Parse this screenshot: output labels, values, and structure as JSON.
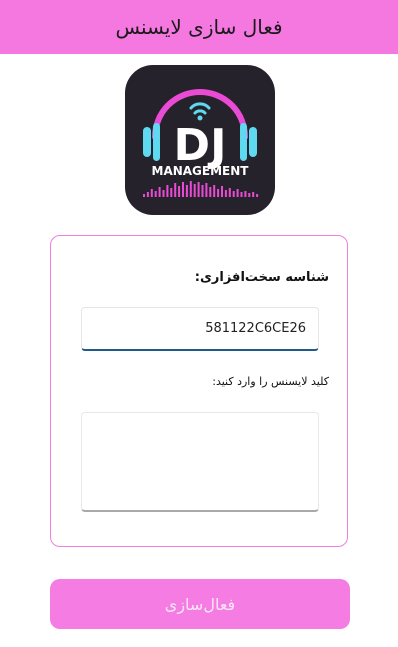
{
  "window": {
    "title": "فعال سازی لایسنس"
  },
  "logo": {
    "main_text": "DJ",
    "sub_text": "MANAGEMENT",
    "accent_pink": "#e94bd4",
    "accent_cyan": "#5ed9f0",
    "background": "#25222c"
  },
  "form": {
    "hardware_id_label": "شناسه سخت‌افزاری:",
    "hardware_id_value": "581122C6CE26",
    "license_label": "کلید لایسنس را وارد کنید:",
    "license_value": ""
  },
  "actions": {
    "activate_label": "فعال‌سازی"
  },
  "colors": {
    "header": "#f577e0",
    "button": "#f47ce2",
    "card_border": "#f07fe0"
  }
}
